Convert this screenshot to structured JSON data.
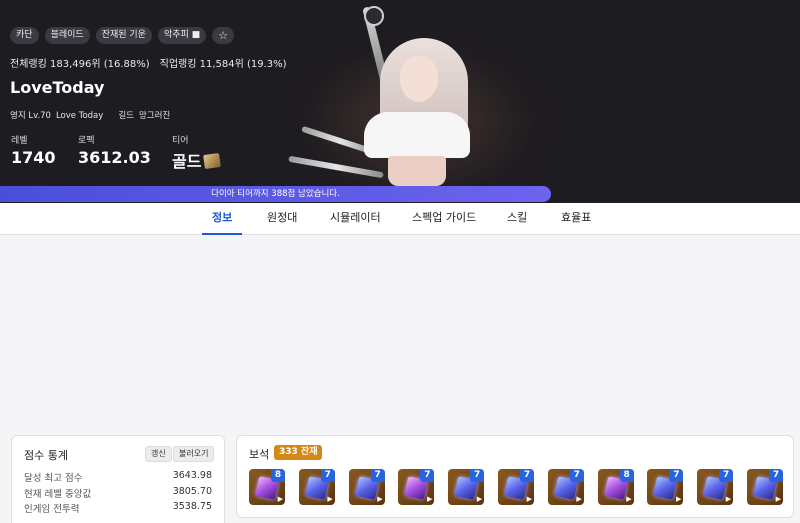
{
  "hero": {
    "tags": [
      "카단",
      "블레이드",
      "잔재된 기운",
      "악추피 ■"
    ],
    "favorite_icon": "star-outline-icon",
    "overall_rank": "전체랭킹 183,496위 (16.88%)",
    "class_rank": "직업랭킹 11,584위 (19.3%)",
    "character_name": "LoveToday",
    "estate": "영지 Lv.70",
    "estate_name": "Love Today",
    "guild_label": "길드",
    "guild_name": "망그러진",
    "level_label": "레벨",
    "level_value": "1740",
    "power_label": "로펙",
    "power_value": "3612.03",
    "tier_label": "티어",
    "tier_value": "골드",
    "tier_icon": "gold-tier-icon"
  },
  "progress": {
    "text": "다이아 티어까지 388점 남았습니다.",
    "fraction": 0.689,
    "color": "#5a5ae6"
  },
  "tabs": [
    {
      "label": "정보",
      "active": true
    },
    {
      "label": "원정대",
      "active": false
    },
    {
      "label": "시뮬레이터",
      "active": false
    },
    {
      "label": "스펙업 가이드",
      "active": false
    },
    {
      "label": "스킬",
      "active": false
    },
    {
      "label": "효율표",
      "active": false
    }
  ],
  "score": {
    "title": "점수 통계",
    "renew_label": "갱신",
    "load_label": "불러오기",
    "rows": [
      {
        "label": "달성 최고 점수",
        "value": "3643.98"
      },
      {
        "label": "현재 레벨 중앙값",
        "value": "3805.70"
      },
      {
        "label": "인게임 전투력",
        "value": "3538.75"
      }
    ]
  },
  "gems": {
    "title": "보석",
    "badge": "333 잔재",
    "accent": "#d68816",
    "items": [
      {
        "level": "8",
        "kind": "purple"
      },
      {
        "level": "7",
        "kind": "blue"
      },
      {
        "level": "7",
        "kind": "blue"
      },
      {
        "level": "7",
        "kind": "purple"
      },
      {
        "level": "7",
        "kind": "blue"
      },
      {
        "level": "7",
        "kind": "blue"
      },
      {
        "level": "7",
        "kind": "blue"
      },
      {
        "level": "8",
        "kind": "purple"
      },
      {
        "level": "7",
        "kind": "blue"
      },
      {
        "level": "7",
        "kind": "blue"
      },
      {
        "level": "7",
        "kind": "blue"
      }
    ]
  }
}
